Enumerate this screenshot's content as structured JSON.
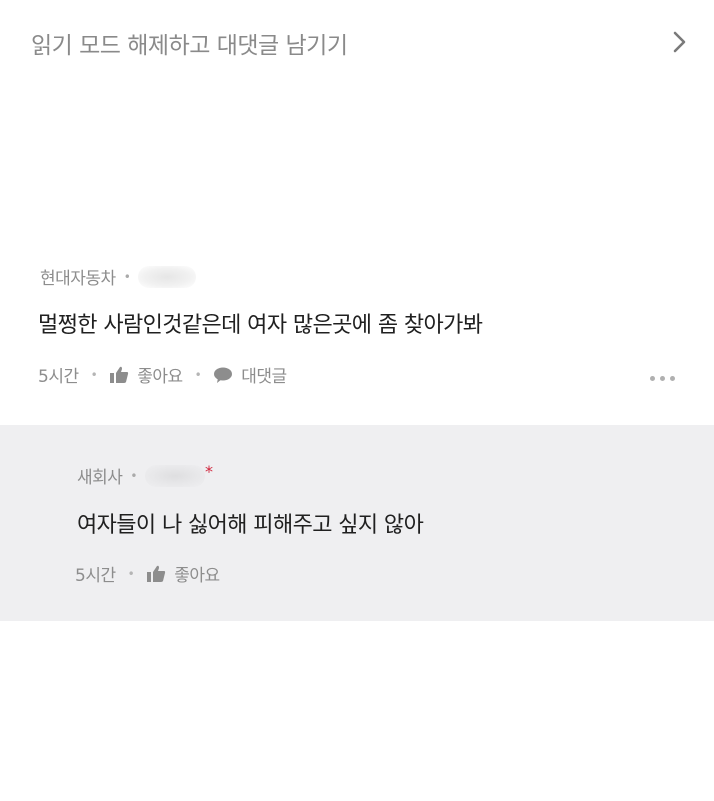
{
  "header": {
    "prompt": "읽기 모드 해제하고 대댓글 남기기",
    "chevron_icon": "chevron-right-icon"
  },
  "comments": [
    {
      "author": "현대자동차",
      "text": "멀쩡한 사람인것같은데 여자 많은곳에 좀 찾아가봐",
      "time": "5시간",
      "like_label": "좋아요",
      "reply_label": "대댓글"
    },
    {
      "author": "새회사",
      "star": "*",
      "text": "여자들이 나 싫어해 피해주고 싶지 않아",
      "time": "5시간",
      "like_label": "좋아요"
    }
  ],
  "colors": {
    "reply_background": "#efeff1",
    "muted_text": "#8d8d8d",
    "accent_star": "#d0253c"
  }
}
